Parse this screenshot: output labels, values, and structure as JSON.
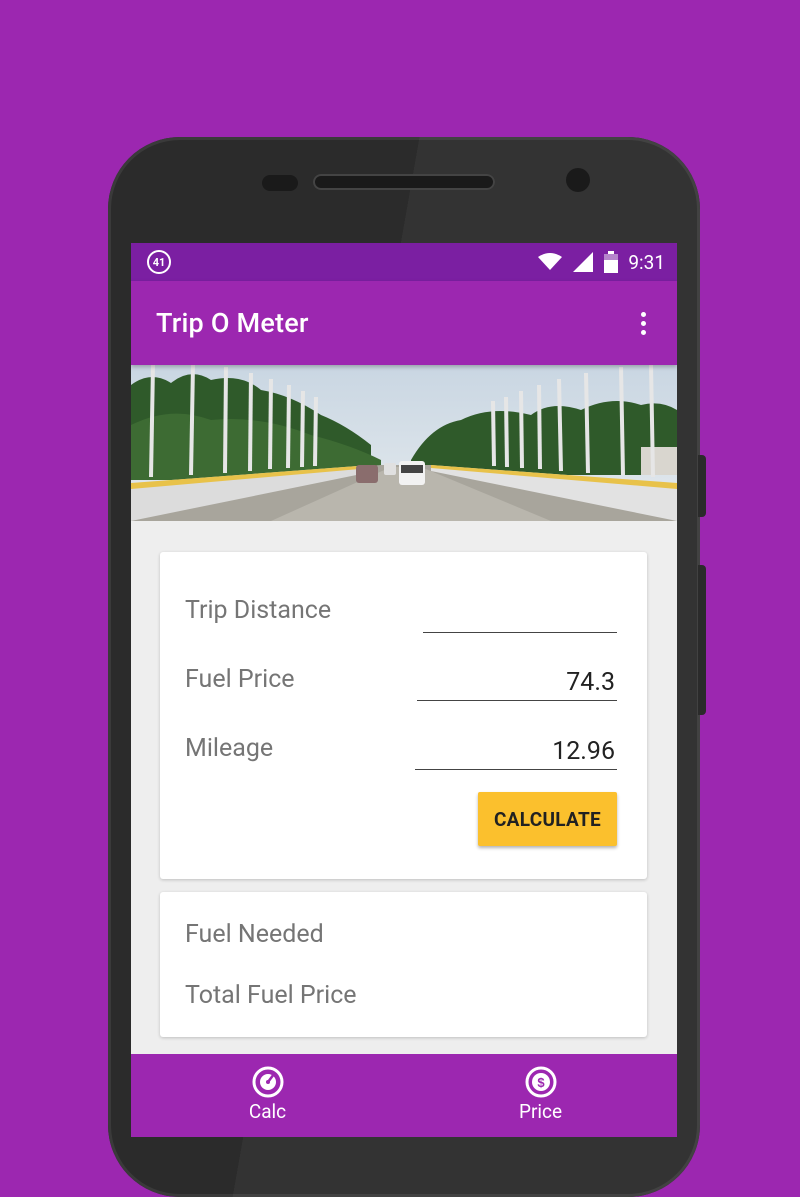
{
  "status_bar": {
    "notification_count": "41",
    "time": "9:31",
    "icons": [
      "wifi-icon",
      "signal-icon",
      "battery-icon"
    ]
  },
  "app_bar": {
    "title": "Trip O Meter",
    "menu_icon": "more-vert-icon"
  },
  "form": {
    "trip_distance": {
      "label": "Trip Distance",
      "value": ""
    },
    "fuel_price": {
      "label": "Fuel Price",
      "value": "74.3"
    },
    "mileage": {
      "label": "Mileage",
      "value": "12.96"
    },
    "calculate_label": "CALCULATE"
  },
  "results": {
    "fuel_needed_label": "Fuel Needed",
    "total_fuel_price_label": "Total Fuel Price"
  },
  "bottom_nav": {
    "items": [
      {
        "label": "Calc",
        "icon": "speedometer-icon"
      },
      {
        "label": "Price",
        "icon": "dollar-coin-icon"
      }
    ]
  },
  "colors": {
    "background": "#9c27b0",
    "status_bar": "#7b1fa2",
    "app_bar": "#9c27b0",
    "accent": "#fbc02d"
  }
}
